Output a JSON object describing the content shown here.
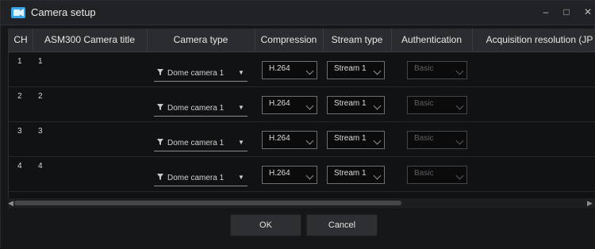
{
  "window": {
    "title": "Camera setup",
    "controls": {
      "minimize": "–",
      "maximize": "□",
      "close": "✕"
    }
  },
  "table": {
    "headers": [
      "CH",
      "ASM300 Camera title",
      "Camera type",
      "Compression",
      "Stream type",
      "Authentication",
      "Acquisition resolution (JP"
    ],
    "rows": [
      {
        "ch": "1",
        "title": "1",
        "camera_type": "Dome camera 1",
        "compression": "H.264",
        "stream": "Stream 1",
        "auth": "Basic"
      },
      {
        "ch": "2",
        "title": "2",
        "camera_type": "Dome camera 1",
        "compression": "H.264",
        "stream": "Stream 1",
        "auth": "Basic"
      },
      {
        "ch": "3",
        "title": "3",
        "camera_type": "Dome camera 1",
        "compression": "H.264",
        "stream": "Stream 1",
        "auth": "Basic"
      },
      {
        "ch": "4",
        "title": "4",
        "camera_type": "Dome camera 1",
        "compression": "H.264",
        "stream": "Stream 1",
        "auth": "Basic"
      }
    ]
  },
  "footer": {
    "ok_label": "OK",
    "cancel_label": "Cancel"
  },
  "icons": {
    "app": "camera-setup-icon",
    "camera_type_filter": "funnel-icon",
    "dropdown": "chevron-down-icon"
  },
  "colors": {
    "window_bg": "#161718",
    "header_bg": "#2a2c2f",
    "select_border": "#6d6f73",
    "accent_icon": "#3aa3e3"
  }
}
